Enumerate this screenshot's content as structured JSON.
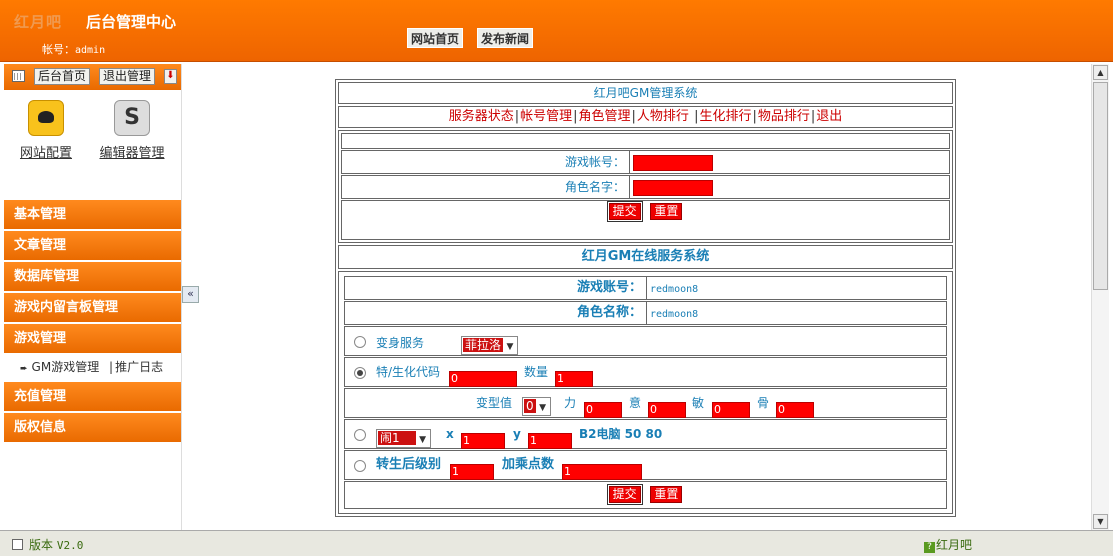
{
  "header": {
    "faded_logo": "红月吧",
    "title": "后台管理中心",
    "account_label": "帐号：",
    "account_value": "admin",
    "nav": [
      "网站首页",
      "发布新闻"
    ]
  },
  "sidebar": {
    "toolbar": {
      "home": "后台首页",
      "logout": "退出管理"
    },
    "icons": [
      {
        "label": "网站配置",
        "icon": "bird-icon"
      },
      {
        "label": "编辑器管理",
        "icon": "editor-icon"
      }
    ],
    "menus": [
      "基本管理",
      "文章管理",
      "数据库管理",
      "游戏内留言板管理",
      "游戏管理",
      "充值管理",
      "版权信息"
    ],
    "sub": {
      "item1": "GM游戏管理",
      "sep": "|",
      "item2": "推广日志"
    }
  },
  "gm": {
    "title": "红月吧GM管理系统",
    "links": [
      "服务器状态",
      "帐号管理",
      "角色管理",
      "人物排行",
      "生化排行",
      "物品排行",
      "退出"
    ],
    "form1": {
      "account_label": "游戏帐号：",
      "role_label": "角色名字：",
      "submit": "提交",
      "reset": "重置"
    },
    "online_title": "红月GM在线服务系统",
    "info": {
      "account_label": "游戏账号：",
      "account_value": "redmoon8",
      "role_label": "角色名称：",
      "role_value": "redmoon8"
    },
    "transform": {
      "label": "变身服务",
      "selected": "菲拉洛"
    },
    "special": {
      "label": "特/生化代码",
      "code": "0",
      "qty_label": "数量",
      "qty": "1"
    },
    "stats": {
      "label": "变型值",
      "type_value": "0",
      "li_label": "力",
      "li": "0",
      "yi_label": "意",
      "yi": "0",
      "min_label": "敏",
      "min": "0",
      "gu_label": "骨",
      "gu": "0"
    },
    "teleport": {
      "selected": "闹1",
      "x_label": "x",
      "x": "1",
      "y_label": "y",
      "y": "1",
      "note": "B2电脑 50 80"
    },
    "rebirth": {
      "level_label": "转生后级别",
      "level": "1",
      "bonus_label": "加乘点数",
      "bonus": "1"
    },
    "submit2": "提交",
    "reset2": "重置"
  },
  "footer": {
    "version_label": "版本",
    "version": "V2.0",
    "brand": "红月吧"
  },
  "colors": {
    "accent": "#ee6400",
    "link": "#1a7fb5",
    "danger": "#ff0000"
  }
}
